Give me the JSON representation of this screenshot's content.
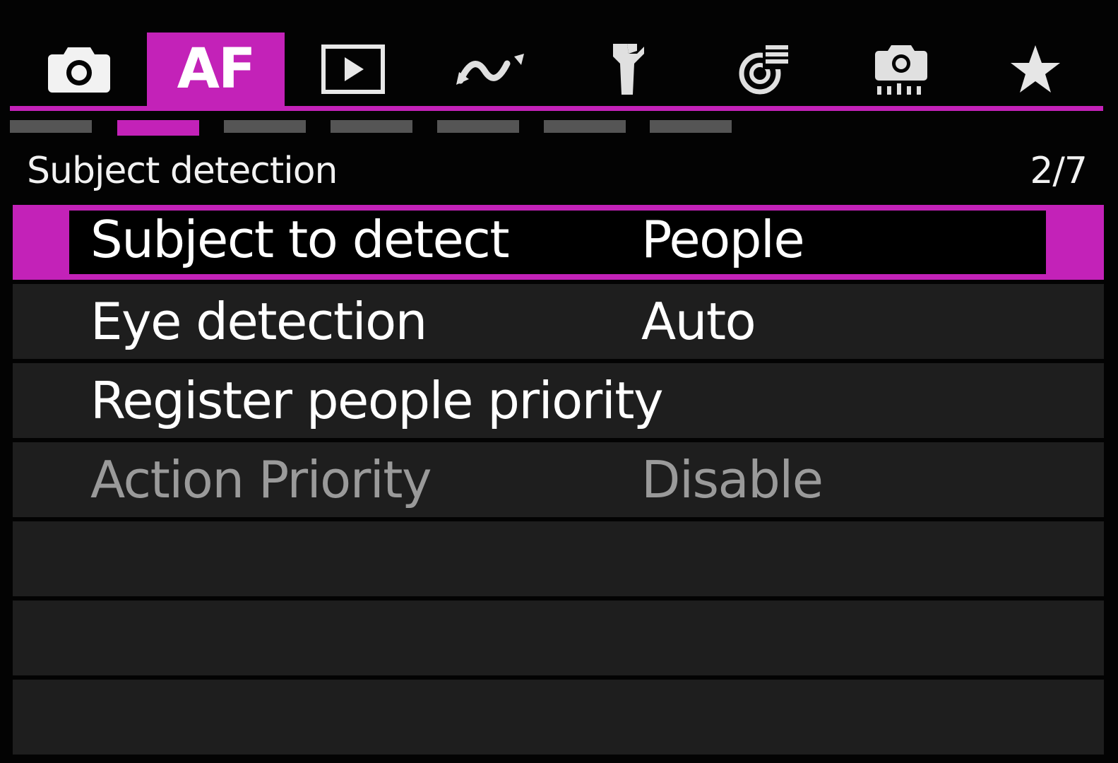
{
  "tabs": [
    {
      "icon": "camera-icon",
      "active": false
    },
    {
      "label": "AF",
      "active": true
    },
    {
      "icon": "playback-icon",
      "active": false
    },
    {
      "icon": "wireless-icon",
      "active": false
    },
    {
      "icon": "wrench-icon",
      "active": false
    },
    {
      "icon": "custom-functions-icon",
      "active": false
    },
    {
      "icon": "custom-shooting-icon",
      "active": false
    },
    {
      "icon": "star-icon",
      "active": false
    }
  ],
  "page_indicators": {
    "count": 7,
    "active_index": 1
  },
  "section": {
    "title": "Subject detection",
    "page": "2/7"
  },
  "menu": {
    "items": [
      {
        "label": "Subject to detect",
        "value": "People",
        "selected": true
      },
      {
        "label": "Eye detection",
        "value": "Auto"
      },
      {
        "label": "Register people priority",
        "value": ""
      },
      {
        "label": "Action Priority",
        "value": "Disable",
        "disabled": true
      }
    ]
  },
  "colors": {
    "accent": "#c322b8",
    "row_background": "#1e1e1e",
    "disabled_text": "#9a9a9a"
  }
}
